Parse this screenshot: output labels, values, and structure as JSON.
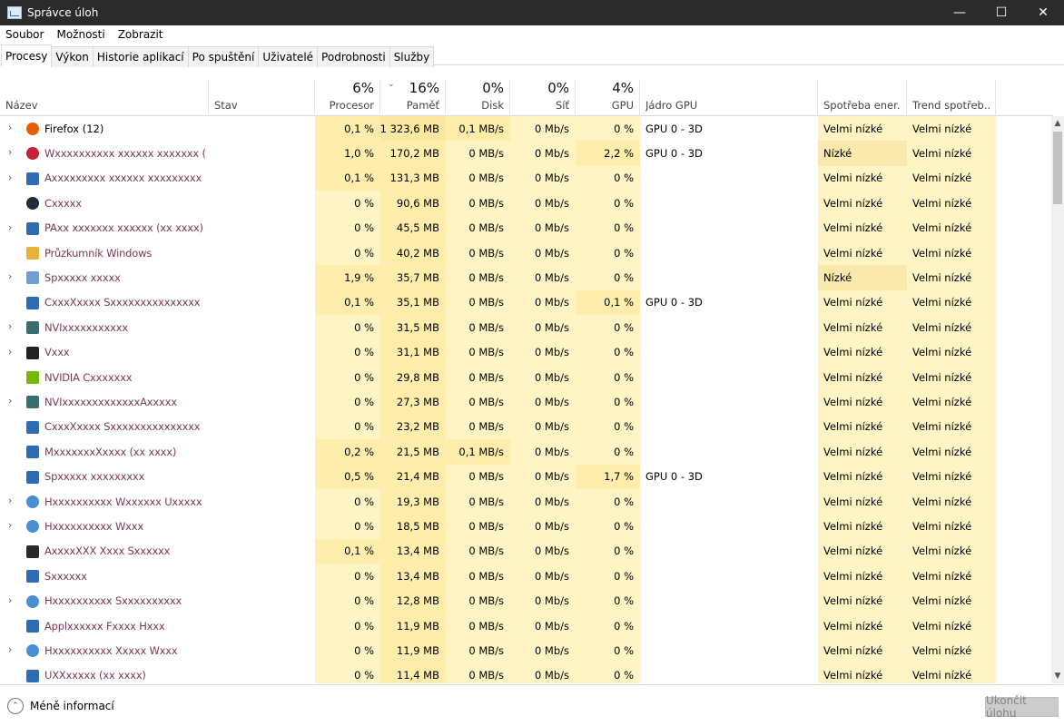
{
  "window": {
    "title": "Správce úloh",
    "minimize": "—",
    "maximize": "☐",
    "close": "✕"
  },
  "menu": [
    "Soubor",
    "Možnosti",
    "Zobrazit"
  ],
  "tabs": [
    "Procesy",
    "Výkon",
    "Historie aplikací",
    "Po spuštění",
    "Uživatelé",
    "Podrobnosti",
    "Služby"
  ],
  "active_tab": 0,
  "header": {
    "name": "Název",
    "status": "Stav",
    "cpu_pct": "6%",
    "cpu": "Procesor",
    "mem_pct": "16%",
    "mem": "Paměť",
    "disk_pct": "0%",
    "disk": "Disk",
    "net_pct": "0%",
    "net": "Síť",
    "gpu_pct": "4%",
    "gpu": "GPU",
    "gpu_engine": "Jádro GPU",
    "power": "Spotřeba ener...",
    "power_trend": "Trend spotřeb..."
  },
  "rows": [
    {
      "name": "Firefox (12)",
      "expand": true,
      "icon": "firefox-icon",
      "color": "#e66000",
      "blurred": false,
      "cpu": "0,1 %",
      "mem": "1 323,6 MB",
      "disk": "0,1 MB/s",
      "net": "0 Mb/s",
      "gpu": "0 %",
      "engine": "GPU 0 - 3D",
      "power": "Velmi nízké",
      "trend": "Velmi nízké"
    },
    {
      "name": "Wxxxxxxxxxx xxxxxx xxxxxxx (",
      "expand": true,
      "icon": "app-red-icon",
      "color": "#c4213a",
      "blurred": true,
      "cpu": "1,0 %",
      "mem": "170,2 MB",
      "disk": "0 MB/s",
      "net": "0 Mb/s",
      "gpu": "2,2 %",
      "engine": "GPU 0 - 3D",
      "power": "Nízké",
      "trend": "Velmi nízké"
    },
    {
      "name": "Axxxxxxxxx xxxxxx xxxxxxxxx",
      "expand": true,
      "icon": "window-icon",
      "color": "#2e6db4",
      "blurred": true,
      "cpu": "0,1 %",
      "mem": "131,3 MB",
      "disk": "0 MB/s",
      "net": "0 Mb/s",
      "gpu": "0 %",
      "engine": "",
      "power": "Velmi nízké",
      "trend": "Velmi nízké"
    },
    {
      "name": "Cxxxxx",
      "expand": false,
      "icon": "dark-circle-icon",
      "color": "#1f2d3d",
      "blurred": true,
      "cpu": "0 %",
      "mem": "90,6 MB",
      "disk": "0 MB/s",
      "net": "0 Mb/s",
      "gpu": "0 %",
      "engine": "",
      "power": "Velmi nízké",
      "trend": "Velmi nízké"
    },
    {
      "name": "PAxx xxxxxxx xxxxxx (xx xxxx)",
      "expand": true,
      "icon": "window-icon",
      "color": "#2e6db4",
      "blurred": true,
      "cpu": "0 %",
      "mem": "45,5 MB",
      "disk": "0 MB/s",
      "net": "0 Mb/s",
      "gpu": "0 %",
      "engine": "",
      "power": "Velmi nízké",
      "trend": "Velmi nízké"
    },
    {
      "name": "Průzkumník Windows",
      "expand": false,
      "icon": "folder-icon",
      "color": "#e8b33a",
      "blurred": true,
      "cpu": "0 %",
      "mem": "40,2 MB",
      "disk": "0 MB/s",
      "net": "0 Mb/s",
      "gpu": "0 %",
      "engine": "",
      "power": "Velmi nízké",
      "trend": "Velmi nízké"
    },
    {
      "name": "Spxxxxx xxxxx",
      "expand": true,
      "icon": "task-icon",
      "color": "#6f9fd0",
      "blurred": true,
      "cpu": "1,9 %",
      "mem": "35,7 MB",
      "disk": "0 MB/s",
      "net": "0 Mb/s",
      "gpu": "0 %",
      "engine": "",
      "power": "Nízké",
      "trend": "Velmi nízké"
    },
    {
      "name": "CxxxXxxxx Sxxxxxxxxxxxxxxx",
      "expand": false,
      "icon": "window-icon",
      "color": "#2e6db4",
      "blurred": true,
      "cpu": "0,1 %",
      "mem": "35,1 MB",
      "disk": "0 MB/s",
      "net": "0 Mb/s",
      "gpu": "0,1 %",
      "engine": "GPU 0 - 3D",
      "power": "Velmi nízké",
      "trend": "Velmi nízké"
    },
    {
      "name": "NVIxxxxxxxxxxx",
      "expand": true,
      "icon": "chip-icon",
      "color": "#3a6e6e",
      "blurred": true,
      "cpu": "0 %",
      "mem": "31,5 MB",
      "disk": "0 MB/s",
      "net": "0 Mb/s",
      "gpu": "0 %",
      "engine": "",
      "power": "Velmi nízké",
      "trend": "Velmi nízké"
    },
    {
      "name": "Vxxx",
      "expand": true,
      "icon": "terminal-icon",
      "color": "#222222",
      "blurred": true,
      "cpu": "0 %",
      "mem": "31,1 MB",
      "disk": "0 MB/s",
      "net": "0 Mb/s",
      "gpu": "0 %",
      "engine": "",
      "power": "Velmi nízké",
      "trend": "Velmi nízké"
    },
    {
      "name": "NVIDIA Cxxxxxxx",
      "expand": false,
      "icon": "nvidia-icon",
      "color": "#76b900",
      "blurred": true,
      "cpu": "0 %",
      "mem": "29,8 MB",
      "disk": "0 MB/s",
      "net": "0 Mb/s",
      "gpu": "0 %",
      "engine": "",
      "power": "Velmi nízké",
      "trend": "Velmi nízké"
    },
    {
      "name": "NVIxxxxxxxxxxxxxAxxxxx",
      "expand": true,
      "icon": "chip-icon",
      "color": "#3a6e6e",
      "blurred": true,
      "cpu": "0 %",
      "mem": "27,3 MB",
      "disk": "0 MB/s",
      "net": "0 Mb/s",
      "gpu": "0 %",
      "engine": "",
      "power": "Velmi nízké",
      "trend": "Velmi nízké"
    },
    {
      "name": "CxxxXxxxx Sxxxxxxxxxxxxxxx",
      "expand": false,
      "icon": "window-icon",
      "color": "#2e6db4",
      "blurred": true,
      "cpu": "0 %",
      "mem": "23,2 MB",
      "disk": "0 MB/s",
      "net": "0 Mb/s",
      "gpu": "0 %",
      "engine": "",
      "power": "Velmi nízké",
      "trend": "Velmi nízké"
    },
    {
      "name": "MxxxxxxxXxxxx (xx xxxx)",
      "expand": false,
      "icon": "window-icon",
      "color": "#2e6db4",
      "blurred": true,
      "cpu": "0,2 %",
      "mem": "21,5 MB",
      "disk": "0,1 MB/s",
      "net": "0 Mb/s",
      "gpu": "0 %",
      "engine": "",
      "power": "Velmi nízké",
      "trend": "Velmi nízké"
    },
    {
      "name": "Spxxxxx xxxxxxxxx",
      "expand": false,
      "icon": "window-icon",
      "color": "#2e6db4",
      "blurred": true,
      "cpu": "0,5 %",
      "mem": "21,4 MB",
      "disk": "0 MB/s",
      "net": "0 Mb/s",
      "gpu": "1,7 %",
      "engine": "GPU 0 - 3D",
      "power": "Velmi nízké",
      "trend": "Velmi nízké"
    },
    {
      "name": "Hxxxxxxxxxx Wxxxxxx Uxxxxx",
      "expand": true,
      "icon": "gear-icon",
      "color": "#4a8fd6",
      "blurred": true,
      "cpu": "0 %",
      "mem": "19,3 MB",
      "disk": "0 MB/s",
      "net": "0 Mb/s",
      "gpu": "0 %",
      "engine": "",
      "power": "Velmi nízké",
      "trend": "Velmi nízké"
    },
    {
      "name": "Hxxxxxxxxxx Wxxx",
      "expand": true,
      "icon": "gear-icon",
      "color": "#4a8fd6",
      "blurred": true,
      "cpu": "0 %",
      "mem": "18,5 MB",
      "disk": "0 MB/s",
      "net": "0 Mb/s",
      "gpu": "0 %",
      "engine": "",
      "power": "Velmi nízké",
      "trend": "Velmi nízké"
    },
    {
      "name": "AxxxxXXX Xxxx Sxxxxxx",
      "expand": false,
      "icon": "dark-square-icon",
      "color": "#2a2a2a",
      "blurred": true,
      "cpu": "0,1 %",
      "mem": "13,4 MB",
      "disk": "0 MB/s",
      "net": "0 Mb/s",
      "gpu": "0 %",
      "engine": "",
      "power": "Velmi nízké",
      "trend": "Velmi nízké"
    },
    {
      "name": "Sxxxxxx",
      "expand": false,
      "icon": "window-icon",
      "color": "#2e6db4",
      "blurred": true,
      "cpu": "0 %",
      "mem": "13,4 MB",
      "disk": "0 MB/s",
      "net": "0 Mb/s",
      "gpu": "0 %",
      "engine": "",
      "power": "Velmi nízké",
      "trend": "Velmi nízké"
    },
    {
      "name": "Hxxxxxxxxxx Sxxxxxxxxxx",
      "expand": true,
      "icon": "gear-icon",
      "color": "#4a8fd6",
      "blurred": true,
      "cpu": "0 %",
      "mem": "12,8 MB",
      "disk": "0 MB/s",
      "net": "0 Mb/s",
      "gpu": "0 %",
      "engine": "",
      "power": "Velmi nízké",
      "trend": "Velmi nízké"
    },
    {
      "name": "Applxxxxxx Fxxxx Hxxx",
      "expand": false,
      "icon": "window-icon",
      "color": "#2e6db4",
      "blurred": true,
      "cpu": "0 %",
      "mem": "11,9 MB",
      "disk": "0 MB/s",
      "net": "0 Mb/s",
      "gpu": "0 %",
      "engine": "",
      "power": "Velmi nízké",
      "trend": "Velmi nízké"
    },
    {
      "name": "Hxxxxxxxxxx Xxxxx Wxxx",
      "expand": true,
      "icon": "gear-icon",
      "color": "#4a8fd6",
      "blurred": true,
      "cpu": "0 %",
      "mem": "11,9 MB",
      "disk": "0 MB/s",
      "net": "0 Mb/s",
      "gpu": "0 %",
      "engine": "",
      "power": "Velmi nízké",
      "trend": "Velmi nízké"
    },
    {
      "name": "UXXxxxxx (xx xxxx)",
      "expand": false,
      "icon": "window-icon",
      "color": "#2e6db4",
      "blurred": true,
      "cpu": "0 %",
      "mem": "11,4 MB",
      "disk": "0 MB/s",
      "net": "0 Mb/s",
      "gpu": "0 %",
      "engine": "",
      "power": "Velmi nízké",
      "trend": "Velmi nízké"
    }
  ],
  "footer": {
    "fewer_details": "Méně informací",
    "end_task": "Ukončit úlohu"
  }
}
